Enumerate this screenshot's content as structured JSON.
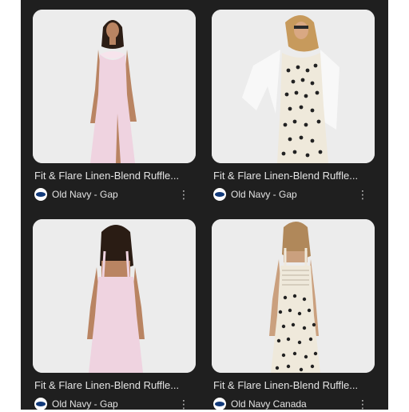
{
  "results": [
    {
      "title": "Fit & Flare Linen-Blend Ruffle...",
      "source": "Old Navy - Gap",
      "image": "woman-in-pink-slip-dress-front-view",
      "dress_color": "#efd3e0"
    },
    {
      "title": "Fit & Flare Linen-Blend Ruffle...",
      "source": "Old Navy - Gap",
      "image": "woman-in-polka-dot-dress-with-white-denim-jacket",
      "dress_color": "#efe9db"
    },
    {
      "title": "Fit & Flare Linen-Blend Ruffle...",
      "source": "Old Navy - Gap",
      "image": "woman-in-pink-slip-dress-back-view",
      "dress_color": "#efd3e0"
    },
    {
      "title": "Fit & Flare Linen-Blend Ruffle...",
      "source": "Old Navy Canada",
      "image": "woman-in-polka-dot-dress-back-view",
      "dress_color": "#efe9db"
    }
  ],
  "colors": {
    "panel_background": "#1f1f1f",
    "text": "#e3e3e3",
    "icon": "#c4c4c4",
    "logo_blue": "#123a7a"
  },
  "icons": {
    "more": "more-vert-icon",
    "source_logo": "old-navy-logo-icon"
  }
}
